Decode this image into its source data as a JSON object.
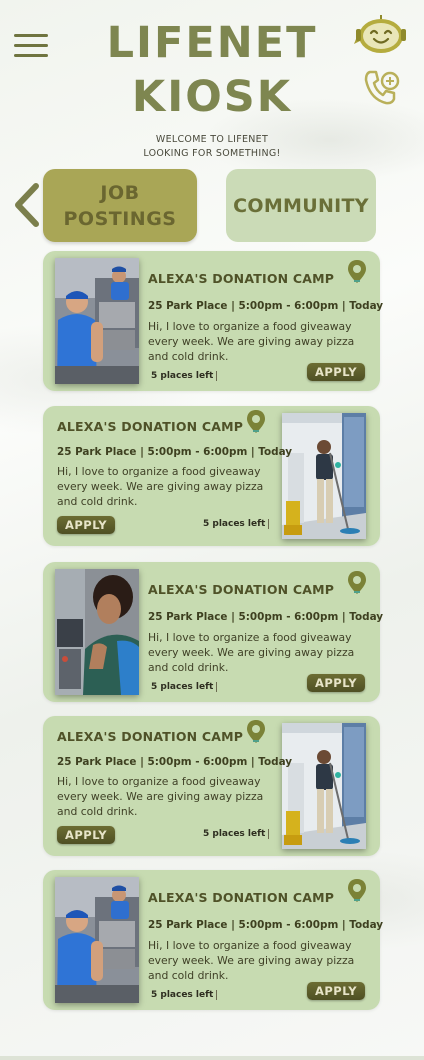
{
  "header": {
    "title_line1": "LIFENET",
    "title_line2": "KIOSK",
    "welcome_line1": "WELCOME TO LIFENET",
    "welcome_line2": "LOOKING FOR SOMETHING!"
  },
  "icons": {
    "menu": "hamburger-icon",
    "assistant": "chatbot-icon",
    "support": "phone-chat-icon",
    "back": "chevron-left-icon",
    "location": "map-pin-icon"
  },
  "tabs": [
    {
      "line1": "JOB",
      "line2": "POSTINGS",
      "active": true
    },
    {
      "label": "COMMUNITY",
      "active": false
    }
  ],
  "colors": {
    "accent_olive": "#7e8650",
    "active_tab": "#a9a656",
    "inactive_tab": "#cbdbb7",
    "card_bg": "#c7dbb1",
    "apply_button": "#5c5d2b"
  },
  "cards": [
    {
      "title": "ALEXA'S DONATION CAMP",
      "info": "25 Park Place | 5:00pm - 6:00pm | Today",
      "desc_line1": "Hi, I love to organize a food giveaway",
      "desc_line2": "every week. We are giving away pizza",
      "desc_line3": "and cold drink.",
      "places": "5 places left",
      "apply": "APPLY",
      "photo": "delivery-man"
    },
    {
      "title": "ALEXA'S DONATION CAMP",
      "info": "25 Park Place | 5:00pm - 6:00pm | Today",
      "desc_line1": "Hi, I love to organize a food giveaway",
      "desc_line2": "every week. We are giving away pizza",
      "desc_line3": "and cold drink.",
      "places": "5 places left",
      "apply": "APPLY",
      "photo": "janitor"
    },
    {
      "title": "ALEXA'S DONATION CAMP",
      "info": "25 Park Place | 5:00pm - 6:00pm | Today",
      "desc_line1": "Hi, I love to organize a food giveaway",
      "desc_line2": "every week. We are giving away pizza",
      "desc_line3": "and cold drink.",
      "places": "5 places left",
      "apply": "APPLY",
      "photo": "worker-woman"
    },
    {
      "title": "ALEXA'S DONATION CAMP",
      "info": "25 Park Place | 5:00pm - 6:00pm | Today",
      "desc_line1": "Hi, I love to organize a food giveaway",
      "desc_line2": "every week. We are giving away pizza",
      "desc_line3": "and cold drink.",
      "places": "5 places left",
      "apply": "APPLY",
      "photo": "janitor"
    },
    {
      "title": "ALEXA'S DONATION CAMP",
      "info": "25 Park Place | 5:00pm - 6:00pm | Today",
      "desc_line1": "Hi, I love to organize a food giveaway",
      "desc_line2": "every week. We are giving away pizza",
      "desc_line3": "and cold drink.",
      "places": "5 places left",
      "apply": "APPLY",
      "photo": "delivery-man"
    }
  ]
}
